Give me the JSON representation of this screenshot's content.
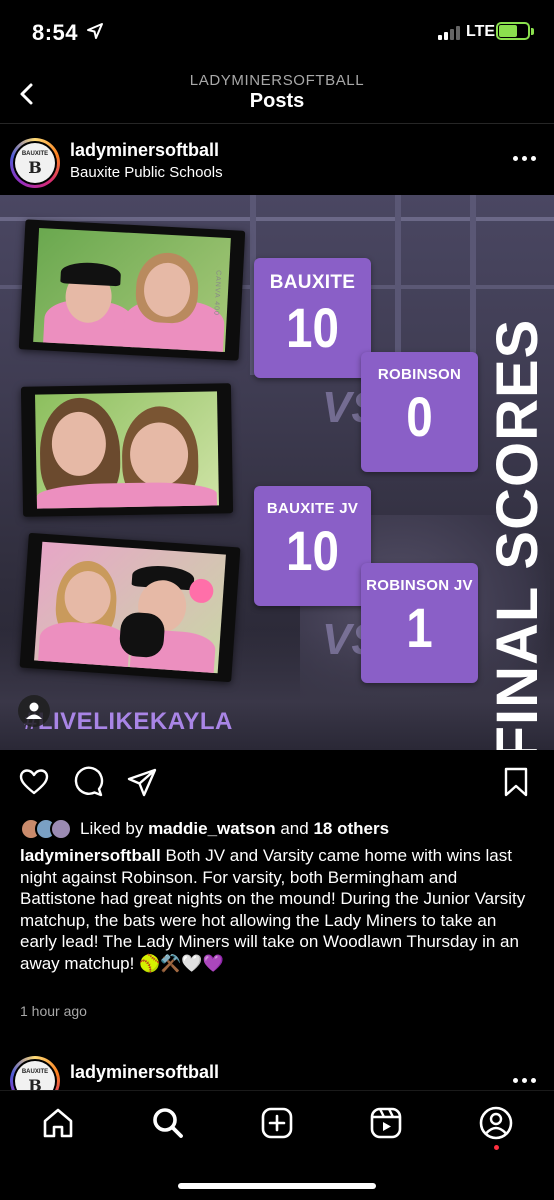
{
  "status_bar": {
    "time": "8:54",
    "network": "LTE"
  },
  "header": {
    "account": "LADYMINERSOFTBALL",
    "title": "Posts"
  },
  "post": {
    "username": "ladyminersoftball",
    "location": "Bauxite Public Schools",
    "avatar_text_top": "BAUXITE",
    "avatar_text_letter": "B",
    "image": {
      "scores": [
        {
          "team": "BAUXITE",
          "score": "10"
        },
        {
          "team": "ROBINSON",
          "score": "0"
        },
        {
          "team": "BAUXITE JV",
          "score": "10"
        },
        {
          "team": "ROBINSON JV",
          "score": "1"
        }
      ],
      "vs_label": "VS",
      "headline": "FINAL SCORES",
      "hashtag": "#LIVELIKEKAYLA",
      "colors": {
        "box": "#8a5fc7",
        "hashtag": "#a985e6"
      }
    },
    "likes": {
      "prefix": "Liked by",
      "user": "maddie_watson",
      "connector": "and",
      "others": "18 others"
    },
    "caption": {
      "username": "ladyminersoftball",
      "text": "Both JV and Varsity came home with wins last night against Robinson. For varsity, both Bermingham and Battistone had great nights on the mound! During the Junior Varsity matchup, the bats were hot allowing the Lady Miners to take an early lead! The Lady Miners will take on Woodlawn Thursday in an away matchup! 🥎⚒️🤍💜"
    },
    "timestamp": "1 hour ago"
  },
  "next_post": {
    "username": "ladyminersoftball"
  },
  "tabbar": {
    "items": [
      "home-icon",
      "search-icon",
      "create-icon",
      "reels-icon",
      "profile-icon"
    ],
    "active": "search-icon"
  }
}
